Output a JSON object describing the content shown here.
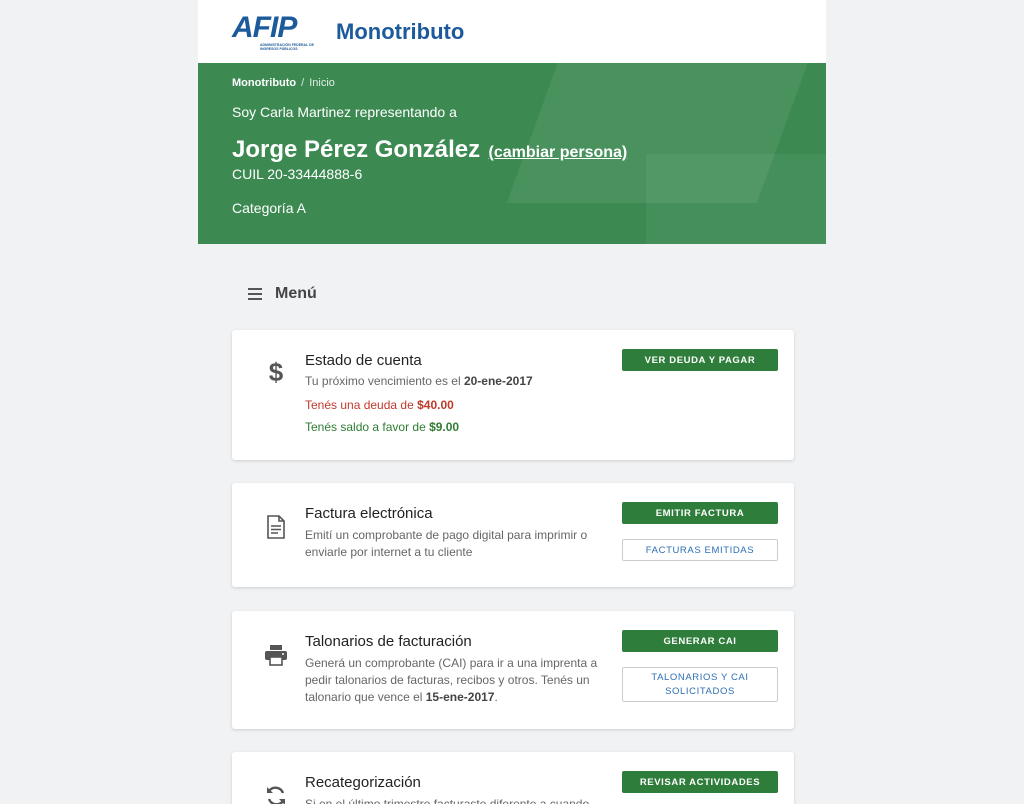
{
  "header": {
    "brand": "AFIP",
    "brand_subtitle": "ADMINISTRACIÓN FEDERAL DE INGRESOS PÚBLICOS",
    "app_name": "Monotributo"
  },
  "breadcrumb": {
    "root": "Monotributo",
    "separator": "/",
    "current": "Inicio"
  },
  "profile": {
    "representing_text": "Soy Carla Martinez representando a",
    "name": "Jorge Pérez González",
    "change_link": "(cambiar persona)",
    "cuil": "CUIL 20-33444888-6",
    "category": "Categoría A"
  },
  "menu": {
    "label": "Menú",
    "icon": "hamburger-icon"
  },
  "cards": {
    "estado": {
      "icon": "dollar-icon",
      "title": "Estado de cuenta",
      "next_due_prefix": "Tu próximo vencimiento es el ",
      "next_due_date": "20-ene-2017",
      "debt_prefix": "Tenés una deuda de ",
      "debt_amount": "$40.00",
      "credit_prefix": "Tenés saldo a favor de ",
      "credit_amount": "$9.00",
      "button": "VER DEUDA Y PAGAR"
    },
    "factura": {
      "icon": "document-icon",
      "title": "Factura electrónica",
      "text": "Emití un comprobante de pago digital para imprimir o enviarle por internet a tu cliente",
      "button_primary": "EMITIR FACTURA",
      "button_secondary": "FACTURAS EMITIDAS"
    },
    "talonarios": {
      "icon": "printer-icon",
      "title": "Talonarios de facturación",
      "text": "Generá un comprobante (CAI) para ir a una imprenta a pedir talonarios de facturas, recibos y otros. Tenés un talonario que vence el ",
      "due_date": "15-ene-2017",
      "text_end": ".",
      "button_primary": "GENERAR CAI",
      "button_secondary": "TALONARIOS Y CAI SOLICITADOS"
    },
    "recategorizacion": {
      "icon": "refresh-icon",
      "title": "Recategorización",
      "text": "Si en el último trimestre facturaste diferente a cuando",
      "button": "REVISAR ACTIVIDADES"
    }
  },
  "colors": {
    "hero_green": "#3c8a52",
    "primary_button": "#2f7d3a",
    "brand_blue": "#1c5a9c",
    "debt_red": "#c0392b",
    "credit_green": "#2e7d32",
    "background": "#f1f2f4"
  }
}
